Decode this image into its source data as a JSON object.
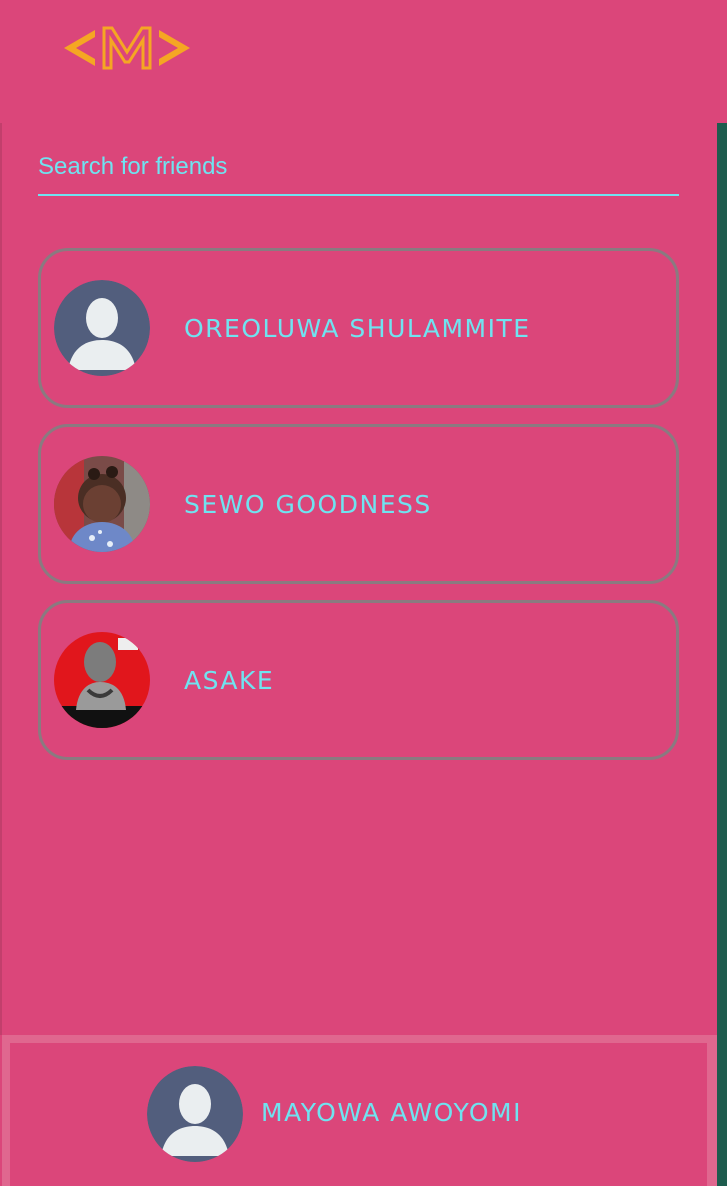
{
  "logo": {
    "text": "<M>",
    "color": "#F5A623"
  },
  "search": {
    "placeholder": "Search for friends",
    "value": ""
  },
  "friends": [
    {
      "name": "OREOLUWA SHULAMMITE",
      "avatar": "default-user-icon"
    },
    {
      "name": "SEWO GOODNESS",
      "avatar": "child-photo"
    },
    {
      "name": "ASAKE",
      "avatar": "artist-photo"
    }
  ],
  "current_user": {
    "name": "MAYOWA AWOYOMI",
    "avatar": "default-user-icon"
  },
  "colors": {
    "background": "#DB467A",
    "accent": "#6FE3F0",
    "card_border": "#8A7A80",
    "side_strip": "#1E5C4E"
  }
}
